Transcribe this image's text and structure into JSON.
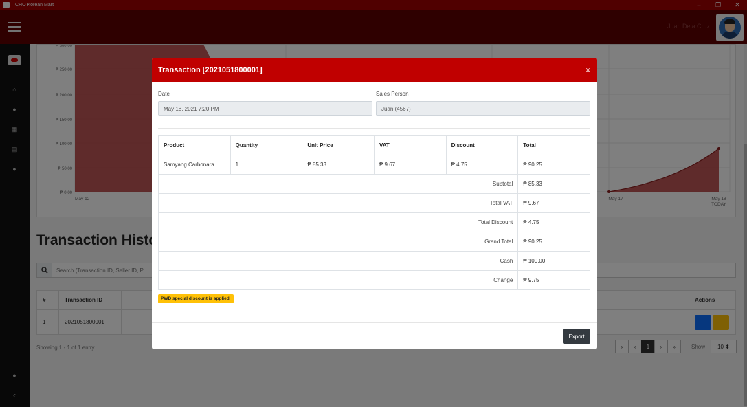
{
  "window": {
    "title": "CHO Korean Mart",
    "minimize": "–",
    "maximize": "❐",
    "close": "✕"
  },
  "header": {
    "user_name": "Juan Dela Cruz"
  },
  "sidebar": {
    "items": [
      {
        "icon": "home-icon",
        "glyph": "⌂"
      },
      {
        "icon": "users-icon",
        "glyph": "●"
      },
      {
        "icon": "calendar-icon",
        "glyph": "▦"
      },
      {
        "icon": "documents-icon",
        "glyph": "▤"
      },
      {
        "icon": "chat-icon",
        "glyph": "●"
      }
    ],
    "bottom": [
      {
        "icon": "user-icon",
        "glyph": "●"
      },
      {
        "icon": "collapse-icon",
        "glyph": "‹"
      }
    ]
  },
  "chart_data": {
    "type": "area",
    "title": "",
    "xlabel": "",
    "ylabel": "",
    "y_tick_labels": [
      "₱ 0.00",
      "₱ 50.00",
      "₱ 100.00",
      "₱ 150.00",
      "₱ 200.00",
      "₱ 250.00",
      "₱ 300.00"
    ],
    "ylim": [
      0,
      300
    ],
    "x_tick_labels": [
      "May 12",
      "May 17",
      "May 18",
      "TODAY"
    ],
    "colors": {
      "fill": "#b33a3a",
      "line": "#8a1f1f"
    },
    "series_segments": [
      {
        "x": [
          "May 12",
          "May 13"
        ],
        "y": [
          300,
          0
        ],
        "note_visible_left_peak": true
      },
      {
        "x": [
          "May 17",
          "May 18"
        ],
        "y": [
          0,
          90.25
        ]
      }
    ]
  },
  "history": {
    "title": "Transaction History",
    "search_placeholder": "Search (Transaction ID, Seller ID, P",
    "columns": {
      "num": "#",
      "id": "Transaction ID",
      "actions": "Actions"
    },
    "rows": [
      {
        "num": "1",
        "id": "2021051800001",
        "partial": "021"
      }
    ],
    "showing": "Showing 1 - 1 of 1 entry.",
    "pager": [
      "«",
      "‹",
      "1",
      "›",
      "»"
    ],
    "show_label": "Show",
    "show_value": "10 ⬍"
  },
  "modal": {
    "title": "Transaction [2021051800001]",
    "close": "×",
    "date_label": "Date",
    "date_value": "May 18, 2021 7:20 PM",
    "sales_label": "Sales Person",
    "sales_value": "Juan (4567)",
    "columns": [
      "Product",
      "Quantity",
      "Unit Price",
      "VAT",
      "Discount",
      "Total"
    ],
    "items": [
      {
        "product": "Samyang Carbonara",
        "qty": "1",
        "unit_price": "₱ 85.33",
        "vat": "₱ 9.67",
        "discount": "₱ 4.75",
        "total": "₱ 90.25"
      }
    ],
    "summary": {
      "subtotal_label": "Subtotal",
      "subtotal": "₱ 85.33",
      "vat_label": "Total VAT",
      "vat": "₱ 9.67",
      "discount_label": "Total Discount",
      "discount": "₱ 4.75",
      "grand_label": "Grand Total",
      "grand": "₱ 90.25",
      "cash_label": "Cash",
      "cash": "₱ 100.00",
      "change_label": "Change",
      "change": "₱ 9.75"
    },
    "badge": "PWD special discount is applied.",
    "export": "Export"
  }
}
